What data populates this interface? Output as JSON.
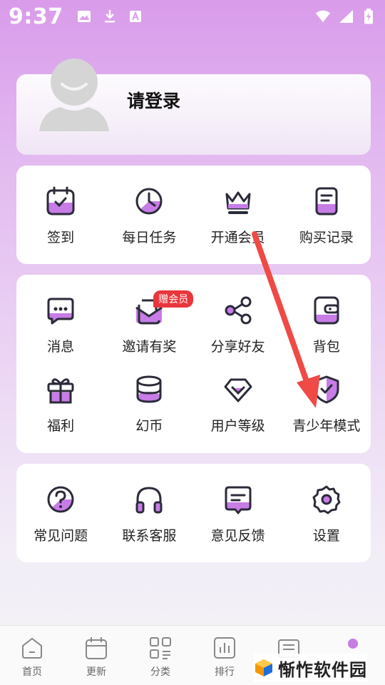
{
  "status_bar": {
    "time": "9:37",
    "left_icons": [
      "image-icon",
      "download-icon",
      "a-badge-icon"
    ],
    "right_icons": [
      "wifi-icon",
      "signal-icon",
      "battery-charging-icon"
    ]
  },
  "profile": {
    "login_label": "请登录",
    "avatar_icon": "default-avatar-icon"
  },
  "quick_actions": [
    {
      "label": "签到",
      "icon": "calendar-check-icon"
    },
    {
      "label": "每日任务",
      "icon": "clock-icon"
    },
    {
      "label": "开通会员",
      "icon": "crown-icon"
    },
    {
      "label": "购买记录",
      "icon": "receipt-icon"
    }
  ],
  "features_row1": [
    {
      "label": "消息",
      "icon": "message-icon"
    },
    {
      "label": "邀请有奖",
      "icon": "invite-mail-icon",
      "badge": "赠会员"
    },
    {
      "label": "分享好友",
      "icon": "share-icon"
    },
    {
      "label": "背包",
      "icon": "wallet-icon"
    }
  ],
  "features_row2": [
    {
      "label": "福利",
      "icon": "gift-icon"
    },
    {
      "label": "幻币",
      "icon": "coin-stack-icon"
    },
    {
      "label": "用户等级",
      "icon": "diamond-icon"
    },
    {
      "label": "青少年模式",
      "icon": "shield-check-icon"
    }
  ],
  "support": [
    {
      "label": "常见问题",
      "icon": "question-icon"
    },
    {
      "label": "联系客服",
      "icon": "headphones-icon"
    },
    {
      "label": "意见反馈",
      "icon": "feedback-icon"
    },
    {
      "label": "设置",
      "icon": "gear-icon"
    }
  ],
  "tab_bar": [
    {
      "label": "首页",
      "icon": "home-icon"
    },
    {
      "label": "更新",
      "icon": "calendar-icon"
    },
    {
      "label": "分类",
      "icon": "category-icon"
    },
    {
      "label": "排行",
      "icon": "chart-icon"
    },
    {
      "label": "",
      "icon": "bookshelf-icon"
    },
    {
      "label": "",
      "icon": "profile-dot-icon"
    }
  ],
  "watermark": {
    "text": "惭怍软件园",
    "icon": "watermark-logo-icon"
  },
  "colors": {
    "accent": "#c77ce6",
    "arrow": "#ef4a46",
    "badge": "#e8363c"
  }
}
